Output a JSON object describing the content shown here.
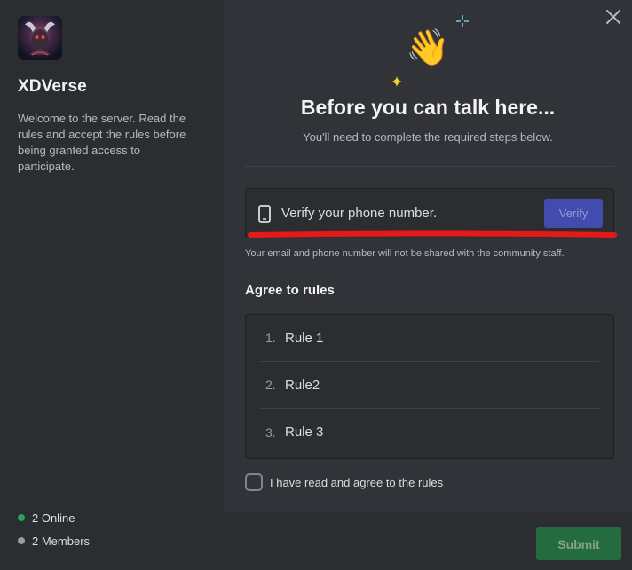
{
  "sidebar": {
    "server_name": "XDVerse",
    "description": "Welcome to the server. Read the rules and accept the rules before being granted access to participate.",
    "online": "2 Online",
    "members": "2 Members"
  },
  "main": {
    "title": "Before you can talk here...",
    "subtitle": "You'll need to complete the required steps below.",
    "verify": {
      "text": "Verify your phone number.",
      "button": "Verify"
    },
    "privacy_note": "Your email and phone number will not be shared with the community staff.",
    "rules_heading": "Agree to rules",
    "rules": [
      {
        "num": "1.",
        "text": "Rule 1"
      },
      {
        "num": "2.",
        "text": "Rule2"
      },
      {
        "num": "3.",
        "text": "Rule 3"
      }
    ],
    "agree_label": "I have read and agree to the rules",
    "agree_checked": false,
    "submit": "Submit"
  },
  "colors": {
    "background": "#313338",
    "sidebar": "#2b2d31",
    "accent": "#4752c4",
    "success": "#248046",
    "online_dot": "#23a55a",
    "annotation": "#e41919"
  },
  "icons": {
    "close": "close-icon",
    "phone": "phone-icon",
    "hero": "waving-hand-icon"
  }
}
